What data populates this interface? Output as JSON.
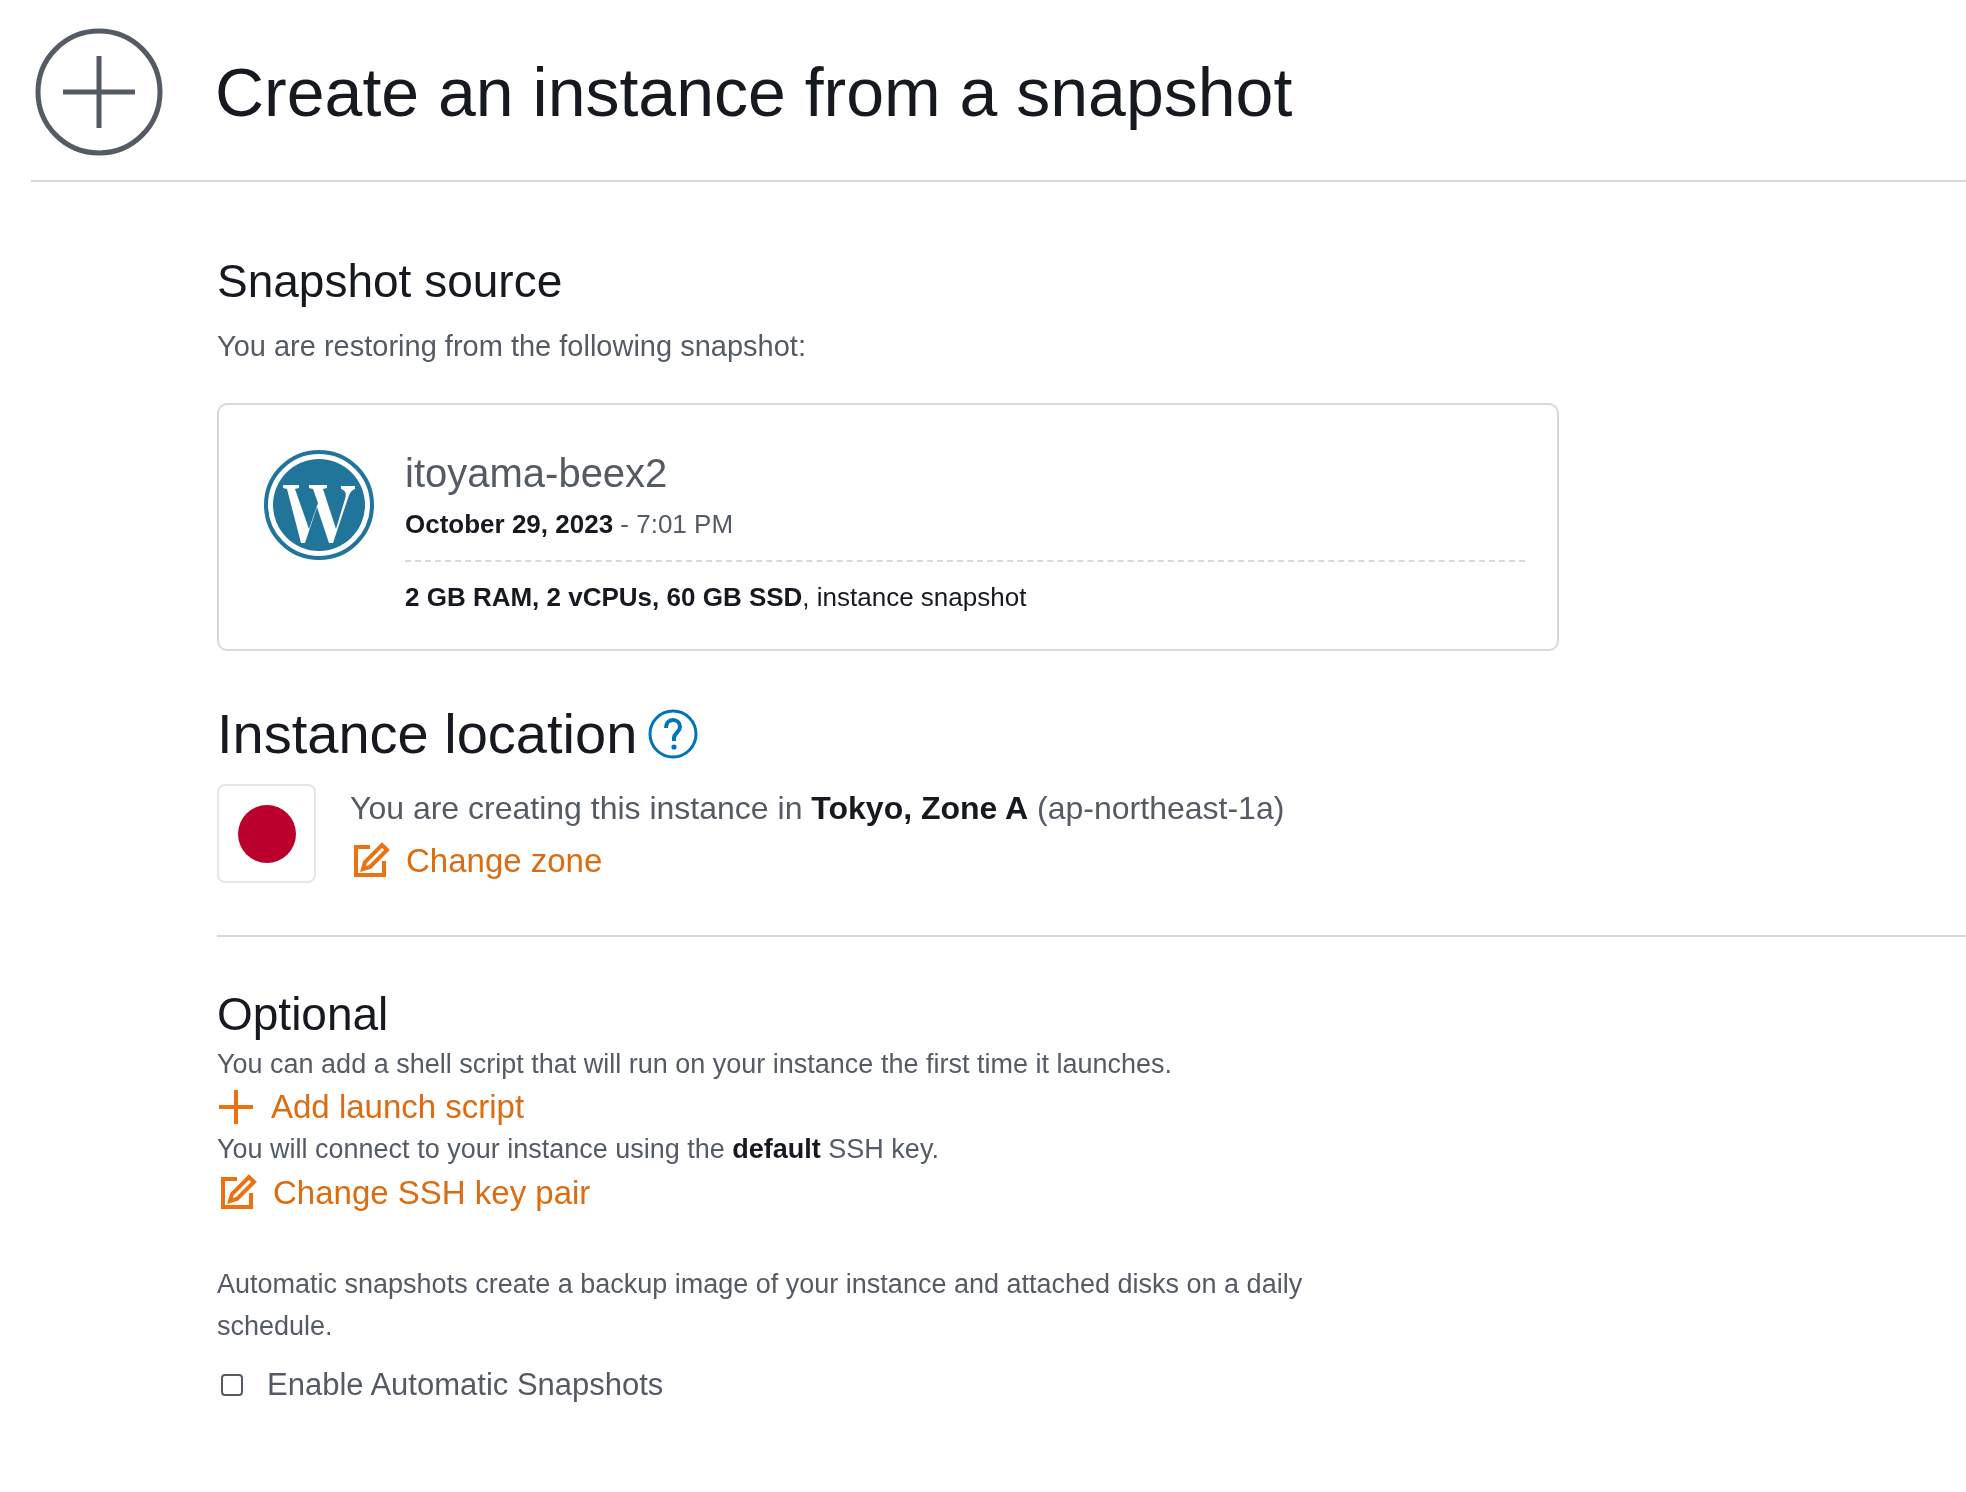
{
  "header": {
    "title": "Create an instance from a snapshot"
  },
  "snapshot_source": {
    "heading": "Snapshot source",
    "intro": "You are restoring from the following snapshot:",
    "card": {
      "name": "itoyama-beex2",
      "date": "**October 29, 2023** - 7:01 PM",
      "specs": "**2 GB RAM, 2 vCPUs, 60 GB SSD**, instance snapshot"
    }
  },
  "instance_location": {
    "heading": "Instance location",
    "description": "You are creating this instance in **Tokyo, Zone A** (ap-northeast-1a)",
    "change_zone": "Change zone"
  },
  "optional": {
    "heading": "Optional",
    "launch_text": "You can add a shell script that will run on your instance the first time it launches.",
    "add_launch_script": "Add launch script",
    "ssh_text": "You will connect to your instance using the **default** SSH key.",
    "change_ssh": "Change SSH key pair",
    "auto_text": "Automatic snapshots create a backup image of your instance and attached disks on a daily schedule.",
    "auto_checkbox": {
      "label": "Enable Automatic Snapshots",
      "checked": false
    }
  }
}
